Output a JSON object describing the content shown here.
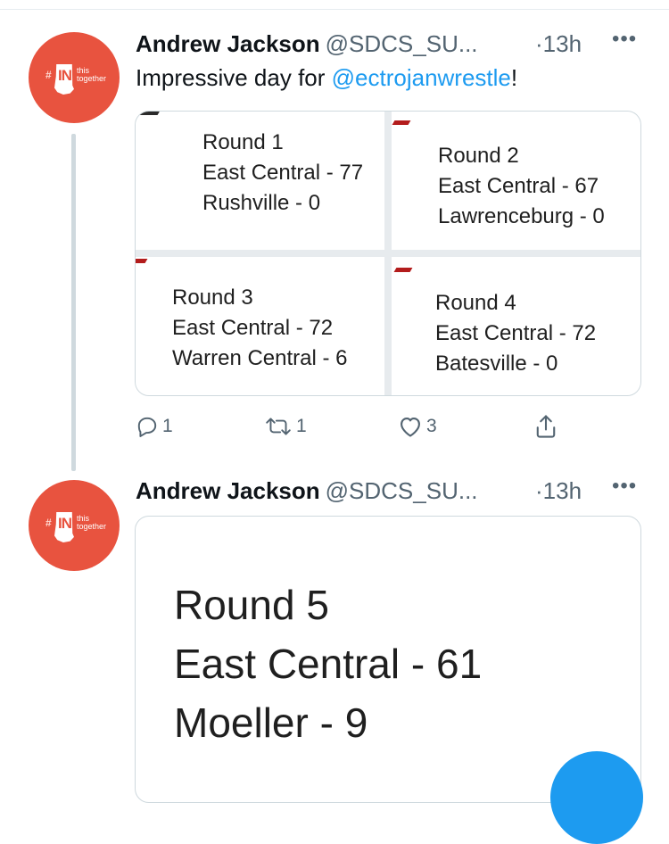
{
  "tweet1": {
    "author": "Andrew Jackson",
    "handle": "@SDCS_SU...",
    "time": "·13h",
    "more": "•••",
    "text_prefix": "Impressive day for ",
    "mention": "@ectrojanwrestle",
    "text_suffix": "!",
    "avatar": {
      "hash": "#",
      "state_text": "IN",
      "tagline_1": "this",
      "tagline_2": "together"
    },
    "images": [
      {
        "round": "Round 1",
        "line1": "East Central - 77",
        "line2": "Rushville - 0"
      },
      {
        "round": "Round 2",
        "line1": "East Central - 67",
        "line2": "Lawrenceburg - 0"
      },
      {
        "round": "Round 3",
        "line1": "East Central - 72",
        "line2": "Warren Central - 6"
      },
      {
        "round": "Round 4",
        "line1": "East Central - 72",
        "line2": "Batesville - 0"
      }
    ],
    "actions": {
      "replies": "1",
      "retweets": "1",
      "likes": "3"
    }
  },
  "tweet2": {
    "author": "Andrew Jackson",
    "handle": "@SDCS_SU...",
    "time": "·13h",
    "more": "•••",
    "avatar": {
      "hash": "#",
      "state_text": "IN",
      "tagline_1": "this",
      "tagline_2": "together"
    },
    "image": {
      "round": "Round 5",
      "line1": "East Central - 61",
      "line2": "Moeller - 9"
    }
  },
  "colors": {
    "accent": "#1d9bf0",
    "avatar_bg": "#e8533f",
    "muted": "#536471",
    "border": "#cfd9de"
  },
  "icons": [
    "reply-icon",
    "retweet-icon",
    "like-icon",
    "share-icon"
  ]
}
